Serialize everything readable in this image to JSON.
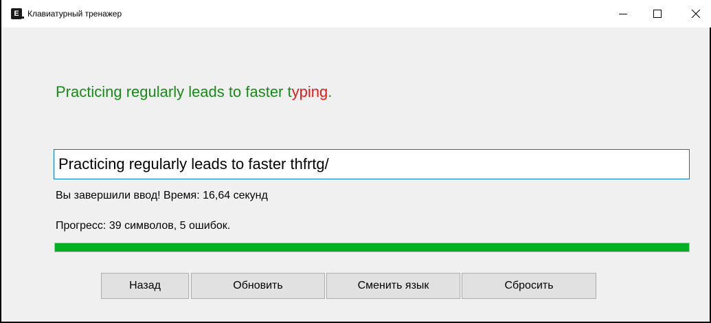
{
  "window": {
    "title": "Клавиатурный тренажер",
    "app_icon_letter": "E",
    "controls": {
      "minimize": "minimize-icon",
      "maximize": "maximize-icon",
      "close": "close-icon"
    }
  },
  "target": {
    "typed_correct": "Practicing regularly leads to faster t",
    "typed_error": "yping",
    "remaining": ".",
    "correct_color": "#178a17",
    "error_color": "#e81919"
  },
  "input": {
    "value": "Practicing regularly leads to faster thfrtg/"
  },
  "status": {
    "done": "Вы завершили ввод! Время: 16,64 секунд",
    "progress": "Прогресс: 39 символов, 5 ошибок."
  },
  "progress_bar": {
    "percent": 100,
    "color": "#06b025"
  },
  "buttons": {
    "back": "Назад",
    "refresh": "Обновить",
    "change_language": "Сменить язык",
    "reset": "Сбросить"
  }
}
